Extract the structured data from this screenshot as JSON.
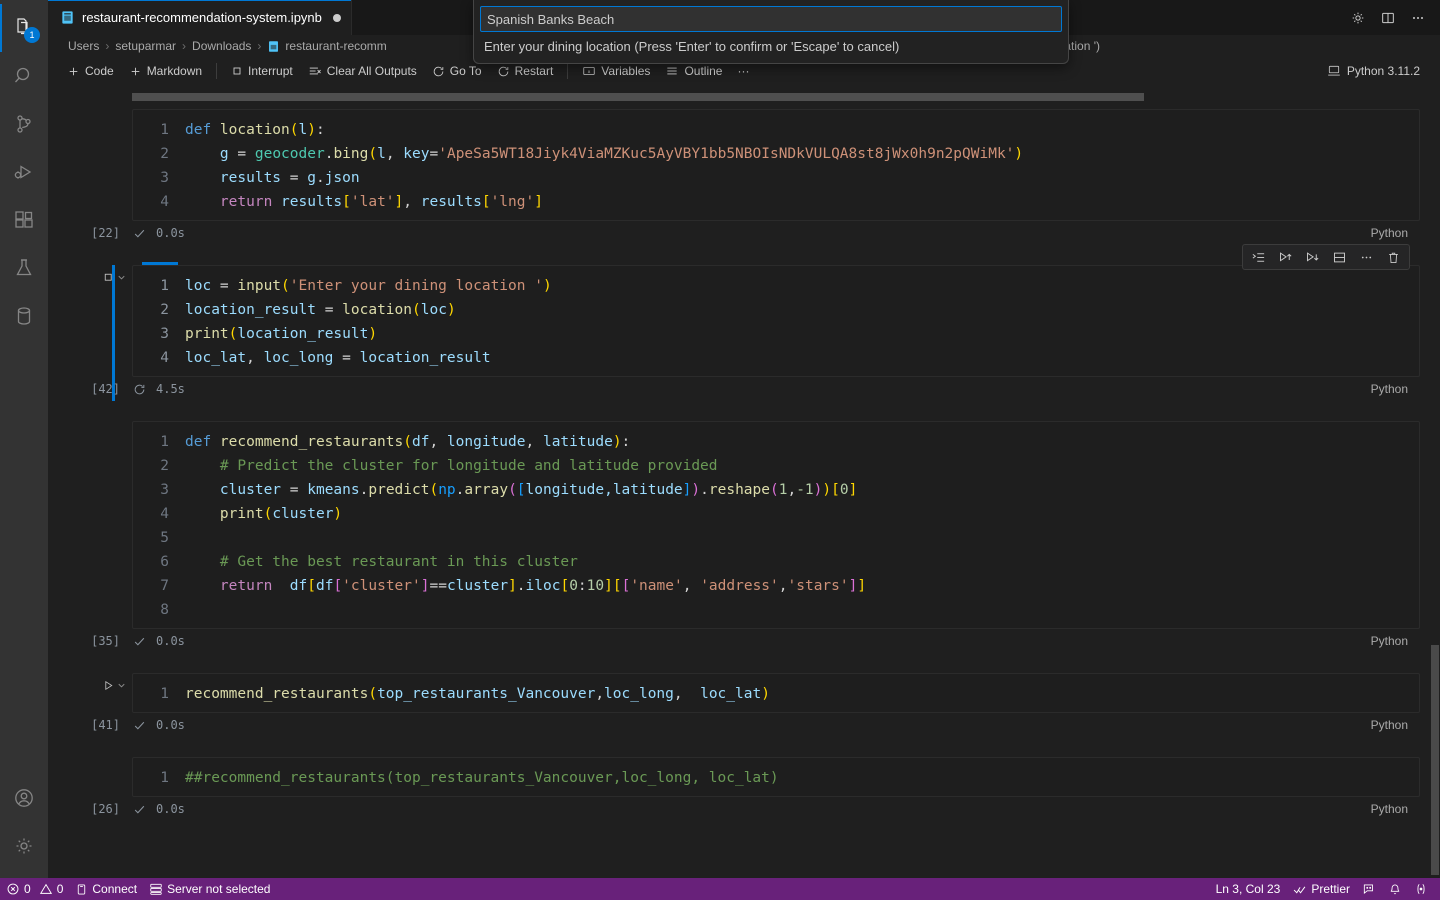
{
  "window": {
    "tab": {
      "title": "restaurant-recommendation-system.ipynb",
      "icon": "notebook-icon",
      "dirty": true
    },
    "editor_actions": [
      {
        "name": "gear-icon",
        "label": "Settings"
      },
      {
        "name": "split-editor-icon",
        "label": "Split Editor Right"
      },
      {
        "name": "more-actions-icon",
        "label": "More Actions..."
      }
    ]
  },
  "breadcrumbs": [
    {
      "label": "Users"
    },
    {
      "label": "setuparmar"
    },
    {
      "label": "Downloads"
    },
    {
      "label": "restaurant-recomm"
    },
    {
      "label": "cation ')"
    }
  ],
  "toolbar": {
    "code_label": "Code",
    "markdown_label": "Markdown",
    "interrupt_label": "Interrupt",
    "clear_outputs_label": "Clear All Outputs",
    "goto_label": "Go To",
    "restart_label": "Restart",
    "variables_label": "Variables",
    "outline_label": "Outline",
    "more_label": "···",
    "kernel_label": "Python 3.11.2"
  },
  "quick_input": {
    "value": "Spanish Banks Beach",
    "description": "Enter your dining location (Press 'Enter' to confirm or 'Escape' to cancel)"
  },
  "cell_toolbar": [
    {
      "name": "run-by-line-icon",
      "label": "Run by Line"
    },
    {
      "name": "execute-above-cells-icon",
      "label": "Execute Above Cells"
    },
    {
      "name": "execute-cell-and-below-icon",
      "label": "Execute Cell and Below"
    },
    {
      "name": "split-cell-icon",
      "label": "Split Cell"
    },
    {
      "name": "more-actions-icon",
      "label": "More Actions"
    },
    {
      "name": "delete-cell-icon",
      "label": "Delete Cell"
    }
  ],
  "activitybar": {
    "items": [
      {
        "name": "explorer-icon",
        "label": "Explorer",
        "badge": "1",
        "active": true
      },
      {
        "name": "search-icon",
        "label": "Search",
        "badge": "",
        "active": false
      },
      {
        "name": "source-control-icon",
        "label": "Source Control",
        "badge": "",
        "active": false
      },
      {
        "name": "run-and-debug-icon",
        "label": "Run and Debug",
        "badge": "",
        "active": false
      },
      {
        "name": "extensions-icon",
        "label": "Extensions",
        "badge": "",
        "active": false
      },
      {
        "name": "testing-icon",
        "label": "Testing",
        "badge": "",
        "active": false
      },
      {
        "name": "database-icon",
        "label": "Database",
        "badge": "",
        "active": false
      }
    ],
    "bottom": [
      {
        "name": "account-icon",
        "label": "Accounts"
      },
      {
        "name": "manage-gear-icon",
        "label": "Manage"
      }
    ]
  },
  "cells": [
    {
      "exec_count": "[22]",
      "status_icon": "success-check",
      "duration": "0.0s",
      "language": "Python",
      "selected": false,
      "lines": [
        {
          "n": "1",
          "tokens": [
            {
              "t": "def ",
              "c": "t-kw"
            },
            {
              "t": "location",
              "c": "t-fn"
            },
            {
              "t": "(",
              "c": "t-pl"
            },
            {
              "t": "l",
              "c": "t-var"
            },
            {
              "t": ")",
              "c": "t-pl"
            },
            {
              "t": ":",
              "c": "t-op"
            }
          ]
        },
        {
          "n": "2",
          "tokens": [
            {
              "t": "    ",
              "c": "t-txt"
            },
            {
              "t": "g ",
              "c": "t-var"
            },
            {
              "t": "= ",
              "c": "t-op"
            },
            {
              "t": "geocoder",
              "c": "t-cls"
            },
            {
              "t": ".",
              "c": "t-op"
            },
            {
              "t": "bing",
              "c": "t-fn"
            },
            {
              "t": "(",
              "c": "t-pl"
            },
            {
              "t": "l",
              "c": "t-var"
            },
            {
              "t": ", ",
              "c": "t-op"
            },
            {
              "t": "key",
              "c": "t-var"
            },
            {
              "t": "=",
              "c": "t-op"
            },
            {
              "t": "'ApeSa5WT18Jiyk4ViaMZKuc5AyVBY1bb5NBOIsNDkVULQA8st8jWx0h9n2pQWiMk'",
              "c": "t-str"
            },
            {
              "t": ")",
              "c": "t-pl"
            }
          ]
        },
        {
          "n": "3",
          "tokens": [
            {
              "t": "    ",
              "c": "t-txt"
            },
            {
              "t": "results ",
              "c": "t-var"
            },
            {
              "t": "= ",
              "c": "t-op"
            },
            {
              "t": "g",
              "c": "t-var"
            },
            {
              "t": ".",
              "c": "t-op"
            },
            {
              "t": "json",
              "c": "t-var"
            }
          ]
        },
        {
          "n": "4",
          "tokens": [
            {
              "t": "    ",
              "c": "t-txt"
            },
            {
              "t": "return ",
              "c": "t-kw2"
            },
            {
              "t": "results",
              "c": "t-var"
            },
            {
              "t": "[",
              "c": "t-pl"
            },
            {
              "t": "'lat'",
              "c": "t-str"
            },
            {
              "t": "]",
              "c": "t-pl"
            },
            {
              "t": ", ",
              "c": "t-op"
            },
            {
              "t": "results",
              "c": "t-var"
            },
            {
              "t": "[",
              "c": "t-pl"
            },
            {
              "t": "'lng'",
              "c": "t-str"
            },
            {
              "t": "]",
              "c": "t-pl"
            }
          ]
        }
      ]
    },
    {
      "exec_count": "[42]",
      "status_icon": "running-sync",
      "duration": "4.5s",
      "language": "Python",
      "selected": true,
      "lines": [
        {
          "n": "1",
          "tokens": [
            {
              "t": "loc ",
              "c": "t-var"
            },
            {
              "t": "= ",
              "c": "t-op"
            },
            {
              "t": "input",
              "c": "t-fn"
            },
            {
              "t": "(",
              "c": "t-pl"
            },
            {
              "t": "'Enter your dining location '",
              "c": "t-str"
            },
            {
              "t": ")",
              "c": "t-pl"
            }
          ]
        },
        {
          "n": "2",
          "tokens": [
            {
              "t": "location_result ",
              "c": "t-var"
            },
            {
              "t": "= ",
              "c": "t-op"
            },
            {
              "t": "location",
              "c": "t-fn"
            },
            {
              "t": "(",
              "c": "t-pl"
            },
            {
              "t": "loc",
              "c": "t-var"
            },
            {
              "t": ")",
              "c": "t-pl"
            }
          ]
        },
        {
          "n": "3",
          "tokens": [
            {
              "t": "print",
              "c": "t-fn"
            },
            {
              "t": "(",
              "c": "t-pl"
            },
            {
              "t": "location_result",
              "c": "t-var"
            },
            {
              "t": ")",
              "c": "t-pl"
            }
          ]
        },
        {
          "n": "4",
          "tokens": [
            {
              "t": "loc_lat",
              "c": "t-var"
            },
            {
              "t": ", ",
              "c": "t-op"
            },
            {
              "t": "loc_long ",
              "c": "t-var"
            },
            {
              "t": "= ",
              "c": "t-op"
            },
            {
              "t": "location_result",
              "c": "t-var"
            }
          ]
        }
      ]
    },
    {
      "exec_count": "[35]",
      "status_icon": "success-check",
      "duration": "0.0s",
      "language": "Python",
      "selected": false,
      "lines": [
        {
          "n": "1",
          "tokens": [
            {
              "t": "def ",
              "c": "t-kw"
            },
            {
              "t": "recommend_restaurants",
              "c": "t-fn"
            },
            {
              "t": "(",
              "c": "t-pl"
            },
            {
              "t": "df",
              "c": "t-var"
            },
            {
              "t": ", ",
              "c": "t-op"
            },
            {
              "t": "longitude",
              "c": "t-var"
            },
            {
              "t": ", ",
              "c": "t-op"
            },
            {
              "t": "latitude",
              "c": "t-var"
            },
            {
              "t": ")",
              "c": "t-pl"
            },
            {
              "t": ":",
              "c": "t-op"
            }
          ]
        },
        {
          "n": "2",
          "tokens": [
            {
              "t": "    # Predict the cluster for longitude and latitude provided",
              "c": "t-com"
            }
          ]
        },
        {
          "n": "3",
          "tokens": [
            {
              "t": "    ",
              "c": "t-txt"
            },
            {
              "t": "cluster ",
              "c": "t-var"
            },
            {
              "t": "= ",
              "c": "t-op"
            },
            {
              "t": "kmeans",
              "c": "t-var"
            },
            {
              "t": ".",
              "c": "t-op"
            },
            {
              "t": "predict",
              "c": "t-fn"
            },
            {
              "t": "(",
              "c": "t-pl"
            },
            {
              "t": "np",
              "c": "t-pl3"
            },
            {
              "t": ".",
              "c": "t-op"
            },
            {
              "t": "array",
              "c": "t-fn"
            },
            {
              "t": "(",
              "c": "t-pl2"
            },
            {
              "t": "[",
              "c": "t-pl3"
            },
            {
              "t": "longitude,latitude",
              "c": "t-var"
            },
            {
              "t": "]",
              "c": "t-pl3"
            },
            {
              "t": ")",
              "c": "t-pl2"
            },
            {
              "t": ".",
              "c": "t-op"
            },
            {
              "t": "reshape",
              "c": "t-fn"
            },
            {
              "t": "(",
              "c": "t-pl2"
            },
            {
              "t": "1",
              "c": "t-num"
            },
            {
              "t": ",",
              "c": "t-op"
            },
            {
              "t": "-1",
              "c": "t-num"
            },
            {
              "t": ")",
              "c": "t-pl2"
            },
            {
              "t": ")",
              "c": "t-pl"
            },
            {
              "t": "[",
              "c": "t-pl"
            },
            {
              "t": "0",
              "c": "t-num"
            },
            {
              "t": "]",
              "c": "t-pl"
            }
          ]
        },
        {
          "n": "4",
          "tokens": [
            {
              "t": "    ",
              "c": "t-txt"
            },
            {
              "t": "print",
              "c": "t-fn"
            },
            {
              "t": "(",
              "c": "t-pl"
            },
            {
              "t": "cluster",
              "c": "t-var"
            },
            {
              "t": ")",
              "c": "t-pl"
            }
          ]
        },
        {
          "n": "5",
          "tokens": [
            {
              "t": "",
              "c": "t-txt"
            }
          ]
        },
        {
          "n": "6",
          "tokens": [
            {
              "t": "    # Get the best restaurant in this cluster",
              "c": "t-com"
            }
          ]
        },
        {
          "n": "7",
          "tokens": [
            {
              "t": "    ",
              "c": "t-txt"
            },
            {
              "t": "return  ",
              "c": "t-kw2"
            },
            {
              "t": "df",
              "c": "t-var"
            },
            {
              "t": "[",
              "c": "t-pl"
            },
            {
              "t": "df",
              "c": "t-var"
            },
            {
              "t": "[",
              "c": "t-pl2"
            },
            {
              "t": "'cluster'",
              "c": "t-str"
            },
            {
              "t": "]",
              "c": "t-pl2"
            },
            {
              "t": "==",
              "c": "t-op"
            },
            {
              "t": "cluster",
              "c": "t-var"
            },
            {
              "t": "]",
              "c": "t-pl"
            },
            {
              "t": ".",
              "c": "t-op"
            },
            {
              "t": "iloc",
              "c": "t-var"
            },
            {
              "t": "[",
              "c": "t-pl"
            },
            {
              "t": "0",
              "c": "t-num"
            },
            {
              "t": ":",
              "c": "t-op"
            },
            {
              "t": "10",
              "c": "t-num"
            },
            {
              "t": "]",
              "c": "t-pl"
            },
            {
              "t": "[",
              "c": "t-pl"
            },
            {
              "t": "[",
              "c": "t-pl2"
            },
            {
              "t": "'name'",
              "c": "t-str"
            },
            {
              "t": ", ",
              "c": "t-op"
            },
            {
              "t": "'address'",
              "c": "t-str"
            },
            {
              "t": ",",
              "c": "t-op"
            },
            {
              "t": "'stars'",
              "c": "t-str"
            },
            {
              "t": "]",
              "c": "t-pl2"
            },
            {
              "t": "]",
              "c": "t-pl"
            }
          ]
        },
        {
          "n": "8",
          "tokens": [
            {
              "t": "",
              "c": "t-txt"
            }
          ]
        }
      ]
    },
    {
      "exec_count": "[41]",
      "status_icon": "success-check",
      "duration": "0.0s",
      "language": "Python",
      "selected": false,
      "has_run_gutter": true,
      "lines": [
        {
          "n": "1",
          "tokens": [
            {
              "t": "recommend_restaurants",
              "c": "t-fn"
            },
            {
              "t": "(",
              "c": "t-pl"
            },
            {
              "t": "top_restaurants_Vancouver",
              "c": "t-var"
            },
            {
              "t": ",",
              "c": "t-op"
            },
            {
              "t": "loc_long",
              "c": "t-var"
            },
            {
              "t": ",  ",
              "c": "t-op"
            },
            {
              "t": "loc_lat",
              "c": "t-var"
            },
            {
              "t": ")",
              "c": "t-pl"
            }
          ]
        }
      ]
    },
    {
      "exec_count": "[26]",
      "status_icon": "success-check",
      "duration": "0.0s",
      "language": "Python",
      "selected": false,
      "lines": [
        {
          "n": "1",
          "tokens": [
            {
              "t": "##recommend_restaurants(top_restaurants_Vancouver,loc_long, loc_lat)",
              "c": "t-com"
            }
          ]
        }
      ]
    }
  ],
  "statusbar": {
    "errors": "0",
    "warnings": "0",
    "connect_label": "Connect",
    "server_label": "Server not selected",
    "position_label": "Ln 3, Col 23",
    "prettier_label": "Prettier"
  },
  "colors": {
    "accent": "#0078d4",
    "statusbar_bg": "#68217a",
    "editor_bg": "#1f1f1f",
    "cell_bg": "#1e1e1e"
  }
}
